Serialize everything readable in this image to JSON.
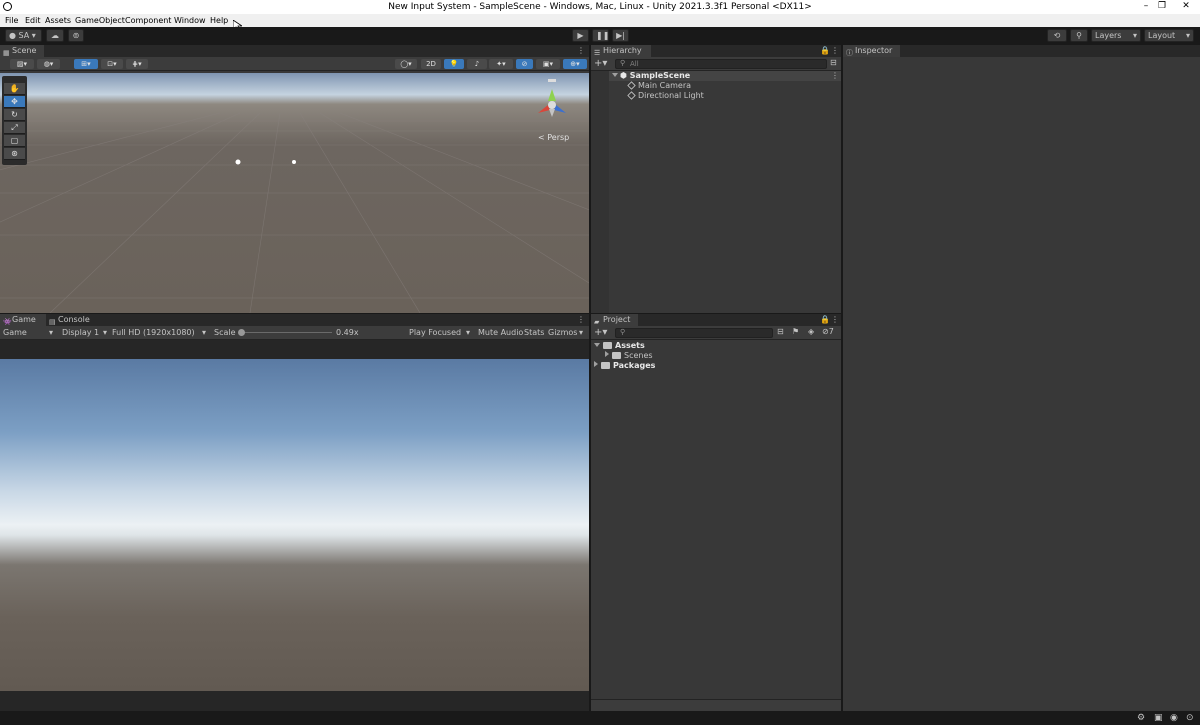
{
  "window": {
    "title": "New Input System - SampleScene - Windows, Mac, Linux - Unity 2021.3.3f1 Personal <DX11>",
    "controls": [
      "–",
      "❐",
      "✕"
    ]
  },
  "menu": [
    "File",
    "Edit",
    "Assets",
    "GameObject",
    "Component",
    "Window",
    "Help"
  ],
  "toolbar": {
    "account": "SA",
    "layers": "Layers",
    "layout": "Layout"
  },
  "scene": {
    "tab": "Scene",
    "toggle_2d": "2D",
    "projection": "< Persp",
    "tools": [
      "hand-tool",
      "move-tool",
      "rotate-tool",
      "scale-tool",
      "rect-tool",
      "transform-tool"
    ]
  },
  "hierarchy": {
    "tab": "Hierarchy",
    "search_placeholder": "All",
    "scene_name": "SampleScene",
    "items": [
      "Main Camera",
      "Directional Light"
    ]
  },
  "inspector": {
    "tab": "Inspector"
  },
  "game": {
    "tab_game": "Game",
    "tab_console": "Console",
    "mode": "Game",
    "display": "Display 1",
    "resolution": "Full HD (1920x1080)",
    "scale_label": "Scale",
    "scale_value": "0.49x",
    "play_focused": "Play Focused",
    "mute_audio": "Mute Audio",
    "stats": "Stats",
    "gizmos": "Gizmos"
  },
  "project": {
    "tab": "Project",
    "hidden_count": "7",
    "tree": [
      {
        "label": "Assets",
        "expanded": true
      },
      {
        "label": "Scenes",
        "expanded": false
      },
      {
        "label": "Packages",
        "expanded": false
      }
    ]
  },
  "colors": {
    "panel_bg": "#383838",
    "tab_bar": "#282828",
    "toolbar_bg": "#191919",
    "accent_blue": "#3a79bb"
  }
}
